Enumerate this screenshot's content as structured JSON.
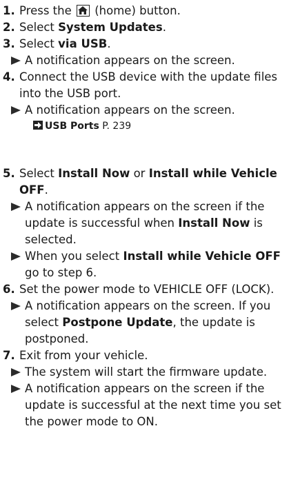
{
  "steps": [
    {
      "num": "1.",
      "pre": "Press the ",
      "icon": "home-icon",
      "post": " (home) button."
    },
    {
      "num": "2.",
      "pre": "Select ",
      "bold": "System Updates",
      "post": "."
    },
    {
      "num": "3.",
      "pre": "Select ",
      "bold": "via USB",
      "post": ".",
      "sub": [
        "A notification appears on the screen."
      ]
    },
    {
      "num": "4.",
      "text": "Connect the USB device with the update files into the USB port.",
      "sub": [
        "A notification appears on the screen."
      ],
      "xref": {
        "label": "USB Ports",
        "page": "P. 239"
      }
    },
    {
      "num": "5.",
      "pre": "Select ",
      "bold1": "Install Now",
      "mid": " or ",
      "bold2": "Install while Vehicle OFF",
      "post": ".",
      "sub1": {
        "pre": "A notification appears on the screen if the update is successful when ",
        "bold": "Install Now",
        "post": " is selected."
      },
      "sub2": {
        "pre": "When you select ",
        "bold": "Install while Vehicle OFF",
        "post": " go to step 6."
      }
    },
    {
      "num": "6.",
      "text": "Set the power mode to VEHICLE OFF (LOCK).",
      "sub1": {
        "pre": "A notification appears on the screen. If you select ",
        "bold": "Postpone Update",
        "post": ", the update is postponed."
      }
    },
    {
      "num": "7.",
      "text": "Exit from your vehicle.",
      "sub": [
        "The system will start the firmware update.",
        "A notification appears on the screen if the update is successful at the next time you set the power mode to ON."
      ]
    }
  ]
}
